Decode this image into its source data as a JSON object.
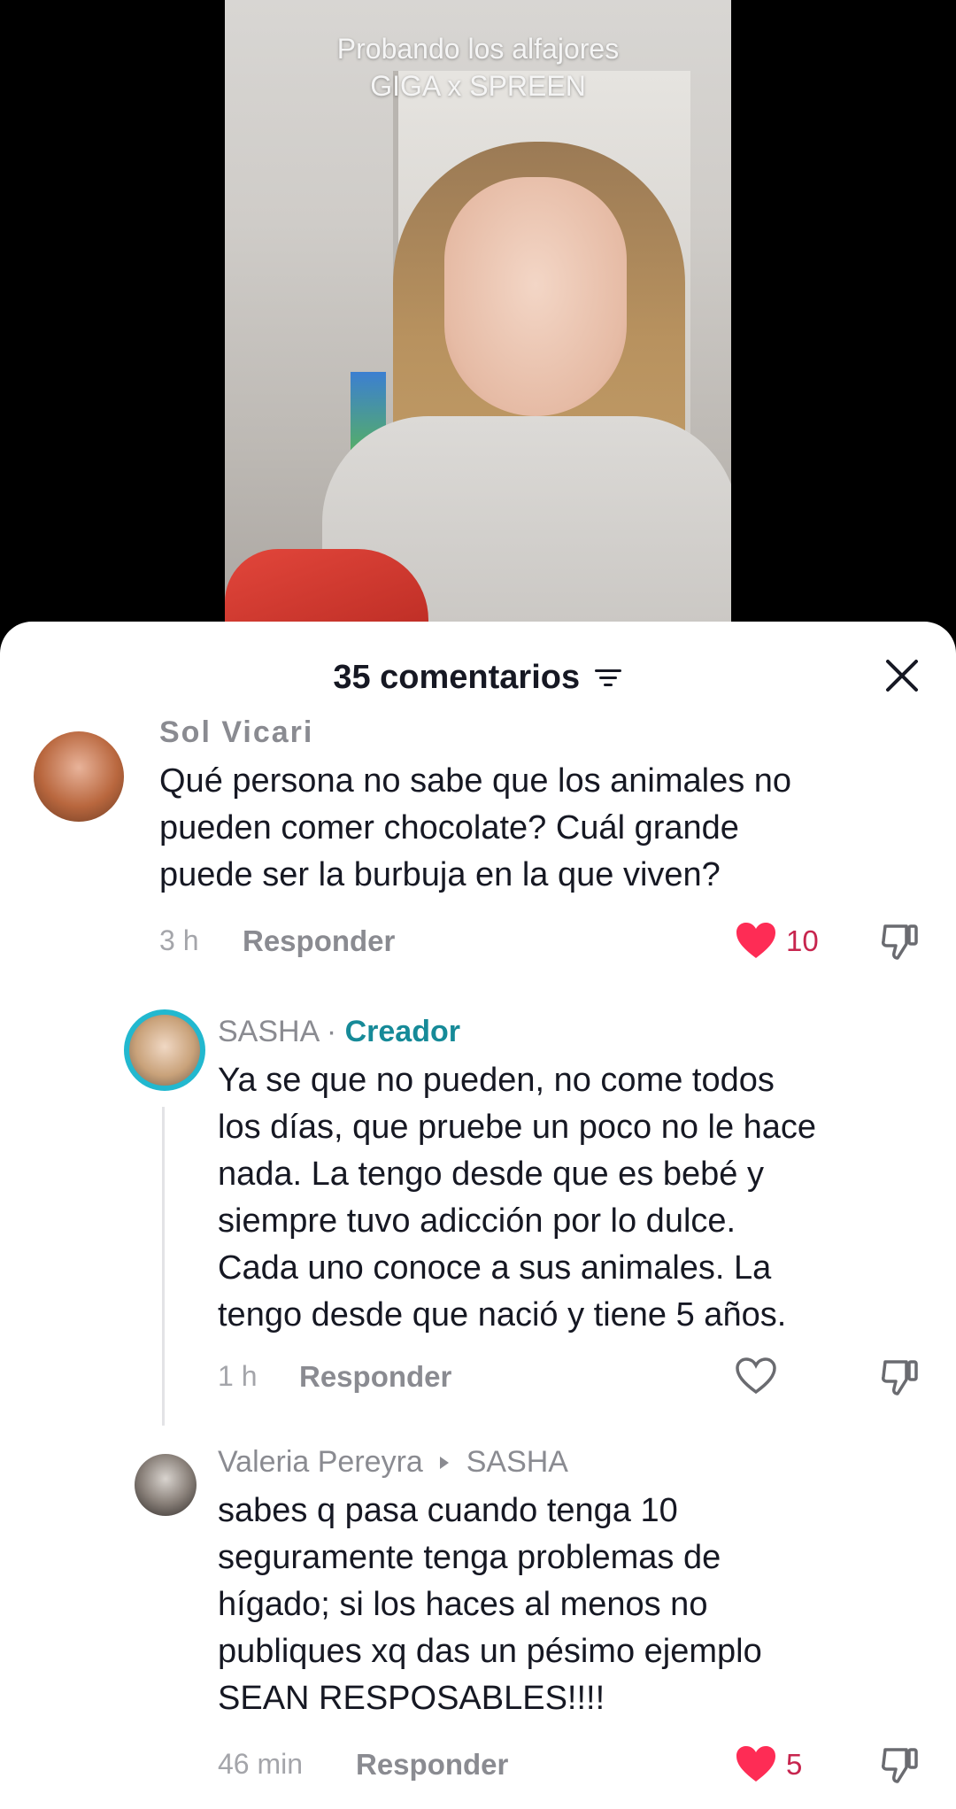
{
  "video": {
    "caption_line1": "Probando los alfajores",
    "caption_line2": "GIGA x SPREEN"
  },
  "sheet": {
    "title": "35 comentarios",
    "sort_icon": "sort-icon",
    "close_icon": "close-icon"
  },
  "comments": [
    {
      "username": "Sol Vicari",
      "lines": [
        "Qué persona no sabe que los animales no",
        "pueden comer chocolate? Cuál grande",
        "puede ser la burbuja en la que viven?"
      ],
      "time": "3 h",
      "reply_label": "Responder",
      "liked": true,
      "likes": "10"
    },
    {
      "username": "SASHA",
      "separator": " · ",
      "badge": "Creador",
      "lines": [
        "Ya se que no pueden, no come todos",
        "los días, que pruebe un poco no le hace",
        "nada. La tengo desde que es bebé y",
        "siempre tuvo adicción por lo dulce.",
        "Cada uno conoce a sus animales. La",
        "tengo desde que nació y tiene 5 años."
      ],
      "time": "1 h",
      "reply_label": "Responder",
      "liked": false,
      "likes": ""
    },
    {
      "username": "Valeria Pereyra",
      "reply_to": "SASHA",
      "lines": [
        "sabes q pasa cuando tenga 10",
        "seguramente tenga problemas de",
        "hígado; si los haces al menos no",
        "publiques xq das un pésimo ejemplo",
        "SEAN RESPOSABLES!!!!"
      ],
      "time": "46 min",
      "reply_label": "Responder",
      "liked": true,
      "likes": "5"
    }
  ],
  "colors": {
    "like_red": "#fe2c55",
    "creator_teal": "#168a98",
    "text_dark": "#161823",
    "text_gray": "#8a8b91"
  }
}
